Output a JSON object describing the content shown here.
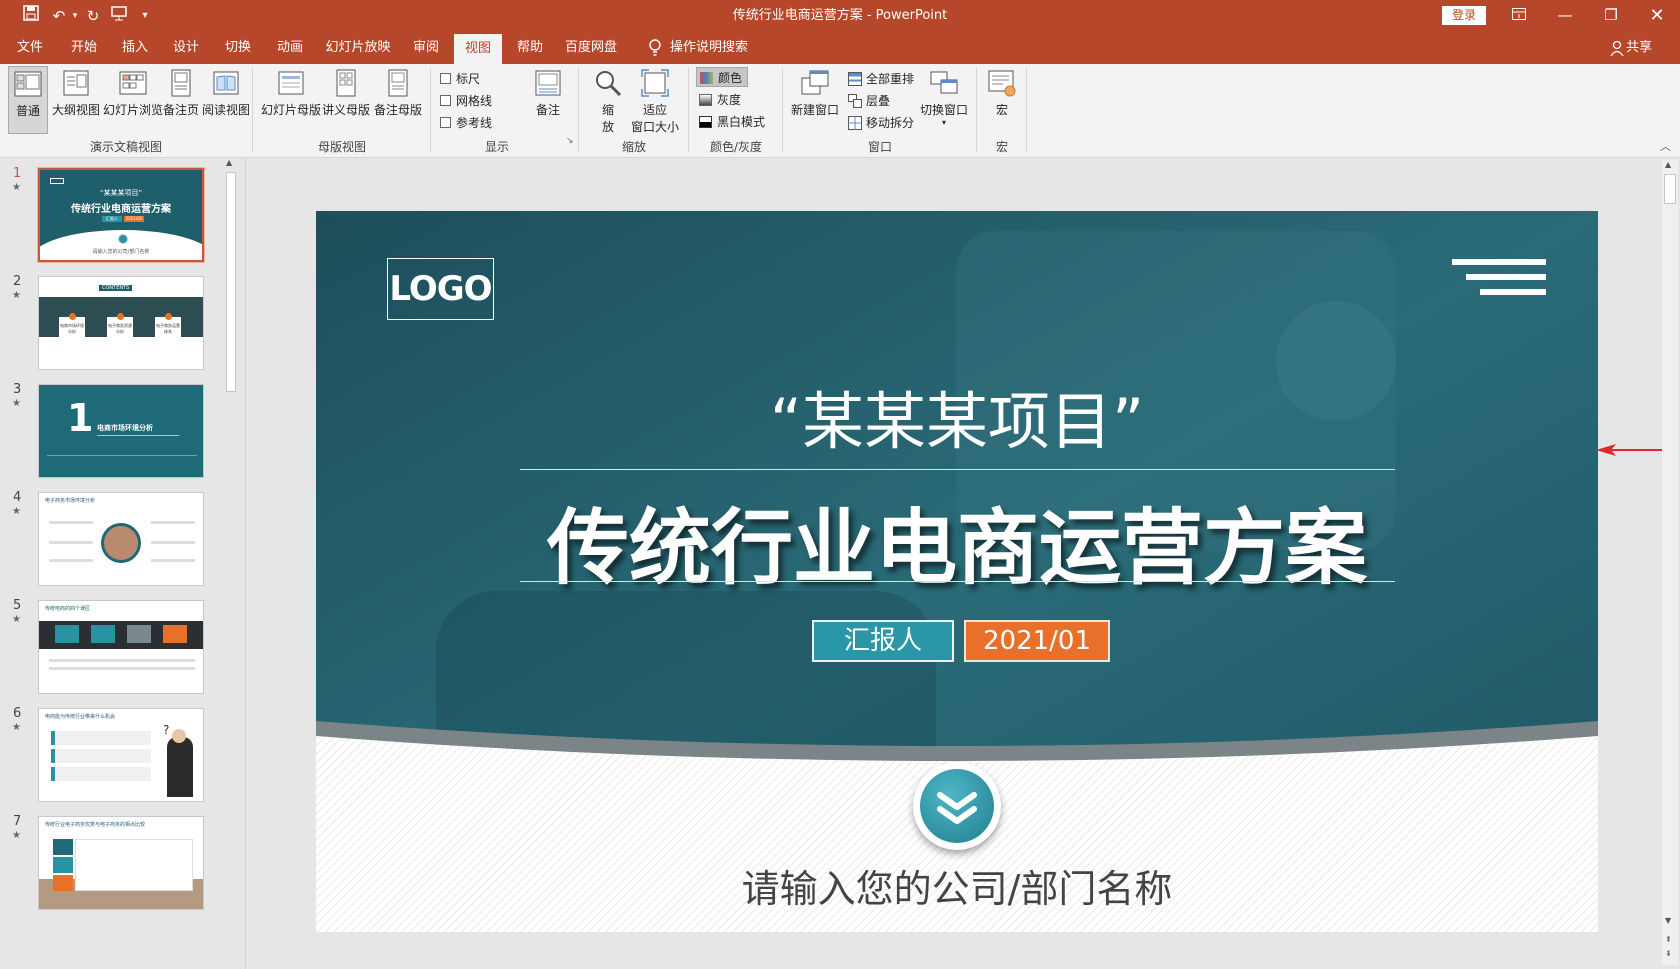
{
  "window": {
    "title": "传统行业电商运营方案  -  PowerPoint",
    "login_label": "登录"
  },
  "quick_access": {
    "save": "save-icon",
    "undo": "undo-icon",
    "redo": "redo-icon",
    "present": "present-icon",
    "customize": "▾"
  },
  "tabs": [
    {
      "label": "文件"
    },
    {
      "label": "开始"
    },
    {
      "label": "插入"
    },
    {
      "label": "设计"
    },
    {
      "label": "切换"
    },
    {
      "label": "动画"
    },
    {
      "label": "幻灯片放映"
    },
    {
      "label": "审阅"
    },
    {
      "label": "视图",
      "active": true
    },
    {
      "label": "帮助"
    },
    {
      "label": "百度网盘"
    }
  ],
  "search_label": "操作说明搜索",
  "share_label": "共享",
  "ribbon": {
    "presentation_views": {
      "group": "演示文稿视图",
      "items": [
        "普通",
        "大纲视图",
        "幻灯片浏览",
        "备注页",
        "阅读视图"
      ]
    },
    "master_views": {
      "group": "母版视图",
      "items": [
        "幻灯片母版",
        "讲义母版",
        "备注母版"
      ]
    },
    "show": {
      "group": "显示",
      "checks": [
        "标尺",
        "网格线",
        "参考线"
      ],
      "notes": "备注"
    },
    "zoom": {
      "group": "缩放",
      "zoom_a": "缩",
      "zoom_b": "放",
      "fit_a": "适应",
      "fit_b": "窗口大小"
    },
    "color": {
      "group": "颜色/灰度",
      "items": [
        "颜色",
        "灰度",
        "黑白模式"
      ]
    },
    "window": {
      "group": "窗口",
      "new_window": "新建窗口",
      "items": [
        "全部重排",
        "层叠",
        "移动拆分"
      ],
      "switch": "切换窗口"
    },
    "macros": {
      "group": "宏",
      "label": "宏"
    }
  },
  "slides": [
    {
      "num": "1",
      "title": "传统行业电商运营方案",
      "sub": "“某某某项目”"
    },
    {
      "num": "2",
      "title": "CONTENTS"
    },
    {
      "num": "3",
      "title": "电商市场环境分析",
      "big": "1"
    },
    {
      "num": "4",
      "title": "电子商务市场环境分析"
    },
    {
      "num": "5",
      "title": "传统电商的四个误区"
    },
    {
      "num": "6",
      "title": "电商能为传统行业带来什么机会"
    },
    {
      "num": "7",
      "title": "传统行业电子商务优势与电子商务的相点比较"
    }
  ],
  "slide": {
    "logo": "LOGO",
    "quote_title": "“某某某项目”",
    "main_title": "传统行业电商运营方案",
    "reporter": "汇报人",
    "date": "2021/01",
    "company": "请输入您的公司/部门名称"
  },
  "thumb_text": {
    "s1_reporter": "汇报人",
    "s1_date": "2021/01",
    "s1_company": "请输入您的公司/部门名称",
    "s2_items": [
      "电商市场环境分析",
      "电子商务资源分析",
      "电子商务运营体系"
    ]
  },
  "colors": {
    "brand": "#b7472a",
    "teal": "#1e6a78",
    "orange": "#e8702a"
  }
}
